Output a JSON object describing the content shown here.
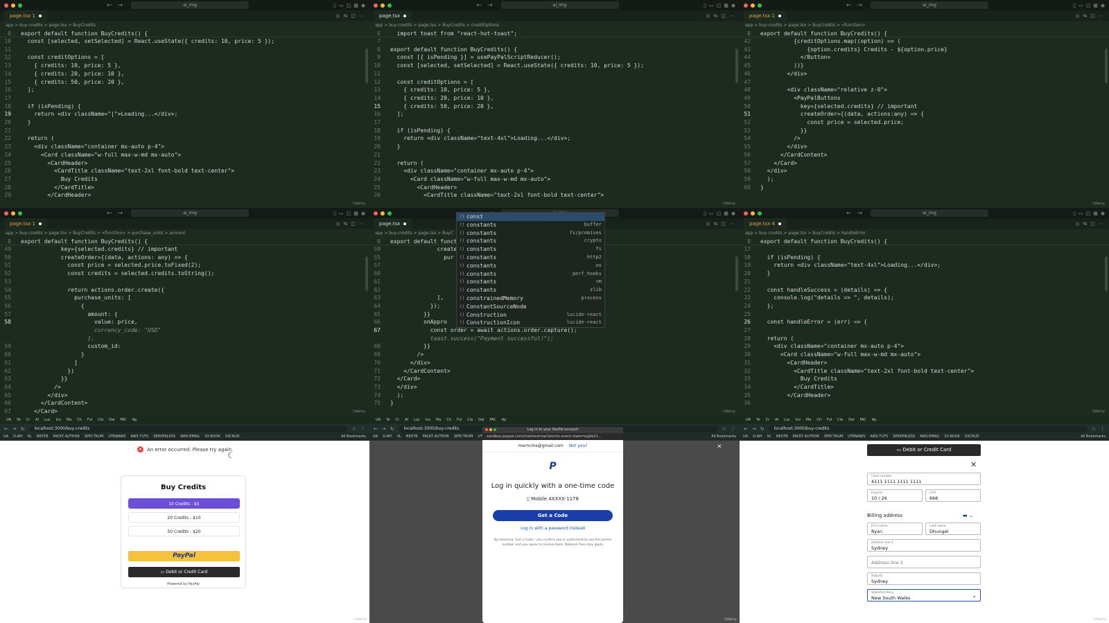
{
  "editor": {
    "workspace": "ai_img",
    "tab_label": "page.tsx",
    "tab_label_error": "page.tsx 1",
    "tab_label_errors4": "page.tsx 4",
    "watermark": "Udemy"
  },
  "panes": [
    {
      "crumb": "app > buy-credits > page.tsx > BuyCredits",
      "sticky": "export default function BuyCredits() {",
      "sticky_num": "8",
      "lines": [
        [
          "10",
          "  const [selected, setSelected] = React.useState({ credits: 10, price: 5 });"
        ],
        [
          "11",
          ""
        ],
        [
          "12",
          "  const creditOptions = ["
        ],
        [
          "13",
          "    { credits: 10, price: 5 },"
        ],
        [
          "14",
          "    { credits: 20, price: 10 },"
        ],
        [
          "15",
          "    { credits: 50, price: 20 },"
        ],
        [
          "16",
          "  ];"
        ],
        [
          "17",
          ""
        ],
        [
          "18",
          "  if (isPending) {"
        ],
        [
          "19",
          "    return <div className=\"|\">Loading...</div>;"
        ],
        [
          "20",
          "  }"
        ],
        [
          "21",
          ""
        ],
        [
          "22",
          "  return ("
        ],
        [
          "23",
          "    <div className=\"container mx-auto p-4\">"
        ],
        [
          "24",
          "      <Card className=\"w-full max-w-md mx-auto\">"
        ],
        [
          "25",
          "        <CardHeader>"
        ],
        [
          "26",
          "          <CardTitle className=\"text-2xl font-bold text-center\">"
        ],
        [
          "27",
          "            Buy Credits"
        ],
        [
          "28",
          "          </CardTitle>"
        ],
        [
          "29",
          "        </CardHeader>"
        ]
      ],
      "cur": "19"
    },
    {
      "crumb": "app > buy-credits > page.tsx > BuyCredits > creditOptions",
      "sticky": "  import toast from \"react-hot-toast\";",
      "sticky_num": "6",
      "lines": [
        [
          "7",
          ""
        ],
        [
          "8",
          "export default function BuyCredits() {"
        ],
        [
          "9",
          "  const [{ isPending }] = usePayPalScriptReducer();"
        ],
        [
          "10",
          "  const [selected, setSelected] = React.useState({ credits: 10, price: 5 });"
        ],
        [
          "11",
          ""
        ],
        [
          "12",
          "  const creditOptions = ["
        ],
        [
          "13",
          "    { credits: 10, price: 5 },"
        ],
        [
          "14",
          "    { credits: 20, price: 10 },"
        ],
        [
          "15",
          "    { credits: 50, price: 20 },"
        ],
        [
          "16",
          "  ];"
        ],
        [
          "17",
          ""
        ],
        [
          "18",
          "  if (isPending) {"
        ],
        [
          "19",
          "    return <div className=\"text-4xl\">Loading...</div>;"
        ],
        [
          "20",
          "  }"
        ],
        [
          "21",
          ""
        ],
        [
          "22",
          "  return ("
        ],
        [
          "23",
          "    <div className=\"container mx-auto p-4\">"
        ],
        [
          "24",
          "      <Card className=\"w-full max-w-md mx-auto\">"
        ],
        [
          "25",
          "        <CardHeader>"
        ],
        [
          "26",
          "          <CardTitle className=\"text-2xl font-bold text-center\">"
        ]
      ],
      "cur": "15"
    },
    {
      "crumb": "app > buy-credits > page.tsx > BuyCredits > <function>",
      "sticky": "export default function BuyCredits() {",
      "sticky_num": "8",
      "lines": [
        [
          "42",
          "          {creditOptions.map((option) => ("
        ],
        [
          "43",
          "              {option.credits} Credits - ${option.price}"
        ],
        [
          "44",
          "            </Button>"
        ],
        [
          "45",
          "          ))}"
        ],
        [
          "46",
          "        </div>"
        ],
        [
          "47",
          ""
        ],
        [
          "48",
          "        <div className=\"relative z-0\">"
        ],
        [
          "49",
          "          <PayPalButtons"
        ],
        [
          "50",
          "            key={selected.credits} // important"
        ],
        [
          "51",
          "            createOrder={(data, actions:any) => {"
        ],
        [
          "52",
          "              const price = selected.price;"
        ],
        [
          "53",
          "            }}"
        ],
        [
          "54",
          "          />"
        ],
        [
          "55",
          "        </div>"
        ],
        [
          "56",
          "      </CardContent>"
        ],
        [
          "57",
          "    </Card>"
        ],
        [
          "58",
          "  </div>"
        ],
        [
          "59",
          "  );"
        ],
        [
          "60",
          "}"
        ]
      ],
      "cur": "51"
    },
    {
      "crumb": "app > buy-credits > page.tsx > BuyCredits > <function> > purchase_units > amount",
      "sticky": "export default function BuyCredits() {",
      "sticky_num": "8",
      "lines": [
        [
          "49",
          "            key={selected.credits} // important"
        ],
        [
          "50",
          "            createOrder={(data, actions: any) => {"
        ],
        [
          "51",
          "              const price = selected.price.toFixed(2);"
        ],
        [
          "52",
          "              const credits = selected.credits.toString();"
        ],
        [
          "53",
          ""
        ],
        [
          "54",
          "              return actions.order.create({"
        ],
        [
          "55",
          "                purchase_units: ["
        ],
        [
          "56",
          "                  {"
        ],
        [
          "57",
          "                    amount: {"
        ],
        [
          "58",
          "                      value: price,"
        ],
        [
          "",
          "                      currency_code: \"USD\""
        ],
        [
          "",
          "                    },"
        ],
        [
          "59",
          "                    custom_id:"
        ],
        [
          "60",
          "                  }"
        ],
        [
          "61",
          "                ]"
        ],
        [
          "62",
          "              })"
        ],
        [
          "63",
          "            }}"
        ],
        [
          "64",
          "          />"
        ],
        [
          "65",
          "        </div>"
        ],
        [
          "66",
          "      </CardContent>"
        ],
        [
          "67",
          "    </Card>"
        ]
      ],
      "cur": "58"
    },
    {
      "crumb": "app > buy-credits > page.tsx > BuyC",
      "sticky": "export default functi",
      "sticky_num": "8",
      "lines": [
        [
          "50",
          "              createO"
        ],
        [
          "55",
          "                pur"
        ],
        [
          "57",
          ""
        ],
        [
          "60",
          ""
        ],
        [
          "61",
          ""
        ],
        [
          "62",
          ""
        ],
        [
          "63",
          "              ],"
        ],
        [
          "64",
          "            });"
        ],
        [
          "65",
          "          }}"
        ],
        [
          "66",
          "          onAppro"
        ],
        [
          "67",
          "            const order = await actions.order.capture();"
        ],
        [
          "",
          "            toast.success(\"Payment successful!\");"
        ],
        [
          "68",
          "          }}"
        ],
        [
          "69",
          "        />"
        ],
        [
          "70",
          "      </div>"
        ],
        [
          "71",
          "    </CardContent>"
        ],
        [
          "72",
          "  </Card>"
        ],
        [
          "73",
          "  </div>"
        ],
        [
          "74",
          "  );"
        ],
        [
          "75",
          "}"
        ]
      ],
      "cur": "67"
    },
    {
      "crumb": "app > buy-credits > page.tsx > BuyCredits > handleError",
      "sticky": "export default function BuyCredits() {",
      "sticky_num": "8",
      "lines": [
        [
          "17",
          ""
        ],
        [
          "18",
          "  if (isPending) {"
        ],
        [
          "19",
          "    return <div className=\"text-4xl\">Loading...</div>;"
        ],
        [
          "20",
          "  }"
        ],
        [
          "21",
          ""
        ],
        [
          "22",
          "  const handleSuccess = (details) => {"
        ],
        [
          "23",
          "    console.log(\"details => \", details);"
        ],
        [
          "24",
          "  };"
        ],
        [
          "25",
          ""
        ],
        [
          "26",
          "  const handleError = (err) => {"
        ],
        [
          "27",
          ""
        ],
        [
          "28",
          "  return ("
        ],
        [
          "29",
          "    <div className=\"container mx-auto p-4\">"
        ],
        [
          "30",
          "      <Card className=\"w-full max-w-md mx-auto\">"
        ],
        [
          "31",
          "        <CardHeader>"
        ],
        [
          "32",
          "          <CardTitle className=\"text-2xl font-bold text-center\">"
        ],
        [
          "33",
          "            Buy Credits"
        ],
        [
          "34",
          "          </CardTitle>"
        ],
        [
          "35",
          "        </CardHeader>"
        ],
        [
          "36",
          ""
        ]
      ],
      "cur": "26"
    }
  ],
  "autocomplete": [
    [
      "const",
      ""
    ],
    [
      "constants",
      "buffer"
    ],
    [
      "constants",
      "fs/promises"
    ],
    [
      "constants",
      "crypto"
    ],
    [
      "constants",
      "fs"
    ],
    [
      "constants",
      "http2"
    ],
    [
      "constants",
      "os"
    ],
    [
      "constants",
      "perf_hooks"
    ],
    [
      "constants",
      "vm"
    ],
    [
      "constants",
      "zlib"
    ],
    [
      "constrainedMemory",
      "process"
    ],
    [
      "ConstantSourceNode",
      ""
    ],
    [
      "Construction",
      "lucide-react"
    ],
    [
      "ConstructionIcon",
      "lucide-react"
    ]
  ],
  "browser": {
    "url": "localhost:3000/buy-credits",
    "tabs": [
      "UA",
      "Ye",
      "Cr",
      "AI",
      "Luc",
      "Ico",
      "Ma",
      "Ch",
      "Ful",
      "Cla",
      "Dal",
      "FAC",
      "Ap"
    ],
    "bookmarks": [
      "UA",
      "D-API",
      "VL",
      "NEXTB",
      "PACKT AUTHOR",
      "SPECTRUM",
      "UTRNAWS",
      "AWS TUTS",
      "SERVERLESS",
      "AWS-EMAIL",
      "S3 BOOK",
      "S3CRUD"
    ],
    "all_bookmarks": "All Bookmarks"
  },
  "buy": {
    "toast": "An error occurred. Please try again.",
    "title": "Buy Credits",
    "options": [
      "10 Credits - $5",
      "20 Credits - $10",
      "50 Credits - $20"
    ],
    "paypal": "PayPal",
    "debit": "Debit or Credit Card",
    "powered": "Powered by PayPal"
  },
  "paypal_modal": {
    "window_title": "Log in to your PayPal account",
    "url": "sandbox.paypal.com/checkoutnow?atomic-event-state=eyJkb21...",
    "email": "merncms@gmail.com",
    "not_you": "Not you?",
    "logo": "P",
    "heading": "Log in quickly with a one-time code",
    "phone": "Mobile 4XXXX-1178",
    "get_code": "Get a Code",
    "password_link": "Log in with a password instead",
    "fine_print": "By selecting \"Get a Code,\" you confirm you're authorised to use this phone number and you agree to receive texts. Network fees may apply."
  },
  "card_form": {
    "button": "Debit or Credit Card",
    "card_label": "Card number",
    "card_value": "4111 1111 1111 1111",
    "exp_label": "Expires",
    "exp_value": "10 / 26",
    "cvv_label": "CVV",
    "cvv_value": "666",
    "billing": "Billing address",
    "first_label": "First name",
    "first_value": "Ryan",
    "last_label": "Last name",
    "last_value": "Dhungel",
    "addr1_label": "Address line 1",
    "addr1_value": "Sydney",
    "addr2_placeholder": "Address line 2",
    "suburb_label": "Suburb",
    "suburb_value": "Sydney",
    "state_label": "State/territory",
    "state_value": "New South Wales"
  }
}
